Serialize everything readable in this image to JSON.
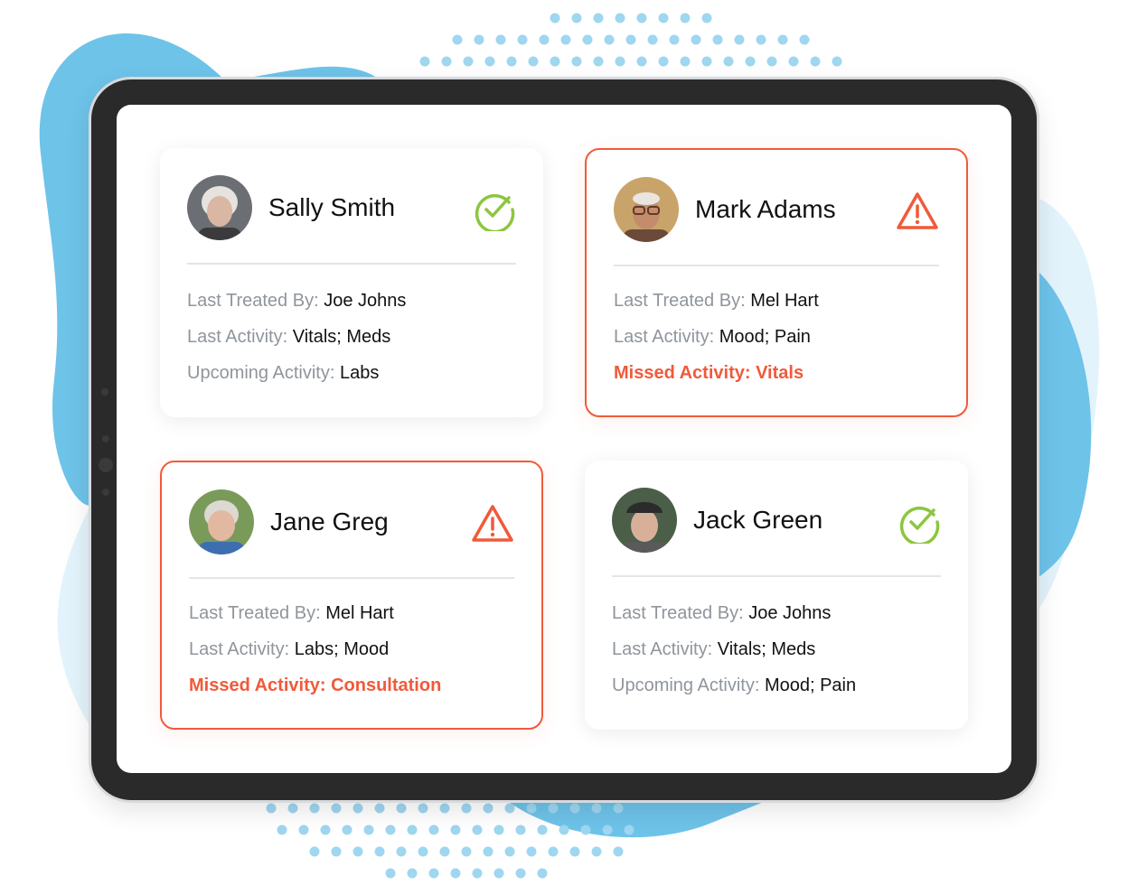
{
  "colors": {
    "accent_blue": "#6ec3e9",
    "light_blue": "#e3f3fb",
    "alert": "#f05a3a",
    "ok": "#8cc63f",
    "label_gray": "#8f959c",
    "device": "#2a2a2a"
  },
  "patients": [
    {
      "name": "Sally Smith",
      "status": "ok",
      "status_icon": "check-circle-icon",
      "rows": [
        {
          "label": "Last Treated By: ",
          "value": "Joe Johns"
        },
        {
          "label": "Last Activity: ",
          "value": "Vitals; Meds"
        },
        {
          "label": "Upcoming Activity: ",
          "value": "Labs"
        }
      ]
    },
    {
      "name": "Mark Adams",
      "status": "alert",
      "status_icon": "warning-triangle-icon",
      "rows": [
        {
          "label": "Last Treated By: ",
          "value": "Mel Hart"
        },
        {
          "label": "Last Activity: ",
          "value": "Mood; Pain"
        }
      ],
      "missed": "Missed Activity: Vitals"
    },
    {
      "name": "Jane Greg",
      "status": "alert",
      "status_icon": "warning-triangle-icon",
      "rows": [
        {
          "label": "Last Treated By: ",
          "value": "Mel Hart"
        },
        {
          "label": "Last Activity: ",
          "value": "Labs; Mood"
        }
      ],
      "missed": "Missed Activity: Consultation"
    },
    {
      "name": "Jack Green",
      "status": "ok",
      "status_icon": "check-circle-icon",
      "rows": [
        {
          "label": "Last Treated By: ",
          "value": "Joe Johns"
        },
        {
          "label": "Last Activity: ",
          "value": "Vitals; Meds"
        },
        {
          "label": "Upcoming Activity: ",
          "value": "Mood; Pain"
        }
      ]
    }
  ]
}
